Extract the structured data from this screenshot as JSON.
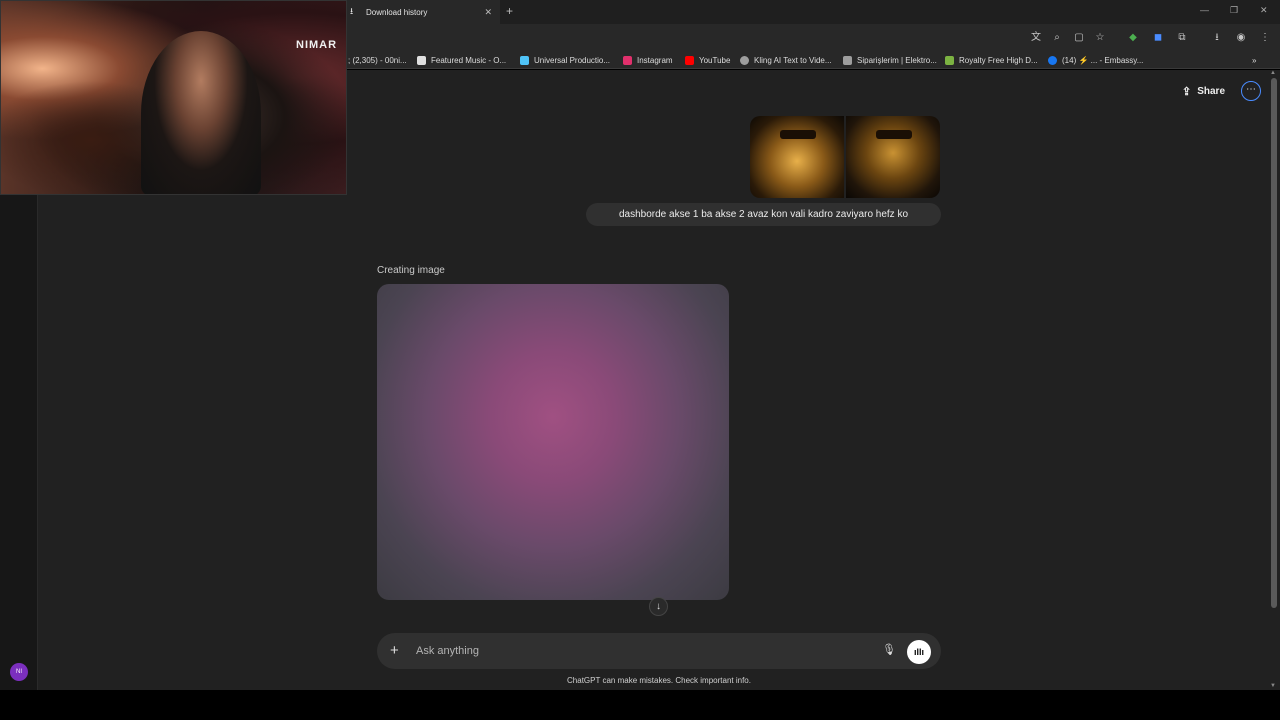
{
  "browser": {
    "tab_title": "Download history",
    "bookmarks": [
      {
        "label": "; (2,305) - 00ni...",
        "color": "#6a6a6a"
      },
      {
        "label": "Featured Music - O...",
        "color": "#e0e0e0"
      },
      {
        "label": "Universal Productio...",
        "color": "#4fc3f7"
      },
      {
        "label": "Instagram",
        "color": "#e1306c"
      },
      {
        "label": "YouTube",
        "color": "#ff0000"
      },
      {
        "label": "Kling AI Text to Vide...",
        "color": "#9e9e9e"
      },
      {
        "label": "Siparişlerim | Elektro...",
        "color": "#9e9e9e"
      },
      {
        "label": "Royalty Free High D...",
        "color": "#7cb342"
      },
      {
        "label": "(14) ⚡ ... - Embassy...",
        "color": "#1877f2"
      }
    ]
  },
  "header": {
    "share_label": "Share",
    "more_icon": "⋯"
  },
  "conversation": {
    "user_message": "dashborde akse 1 ba akse 2 avaz kon vali kadro zaviyaro hefz ko",
    "status_text": "Creating image"
  },
  "composer": {
    "placeholder": "Ask anything",
    "disclaimer": "ChatGPT can make mistakes. Check important info."
  },
  "sidebar": {
    "avatar_initials": "NI"
  },
  "webcam": {
    "sign_text": "NIMAR"
  }
}
